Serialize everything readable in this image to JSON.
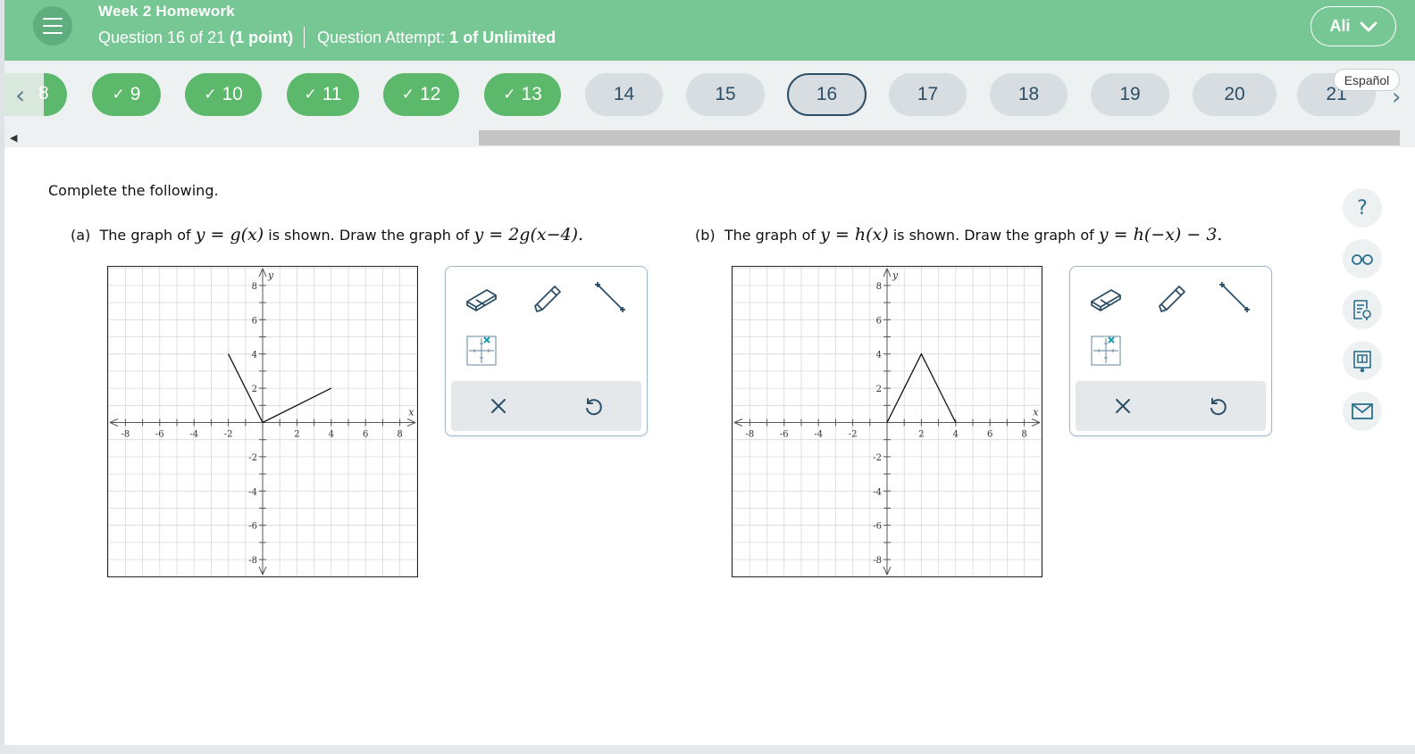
{
  "header": {
    "assignment_title": "Week 2 Homework",
    "question_label": "Question 16 of 21",
    "points_label": "(1 point)",
    "attempt_label": "Question Attempt:",
    "attempt_value": "1 of Unlimited",
    "user_name": "Ali"
  },
  "question_nav": {
    "prev_partial": "8",
    "language_button": "Español",
    "items": [
      {
        "label": "9",
        "status": "correct"
      },
      {
        "label": "10",
        "status": "correct"
      },
      {
        "label": "11",
        "status": "correct"
      },
      {
        "label": "12",
        "status": "correct"
      },
      {
        "label": "13",
        "status": "correct"
      },
      {
        "label": "14",
        "status": "unanswered"
      },
      {
        "label": "15",
        "status": "unanswered"
      },
      {
        "label": "16",
        "status": "current"
      },
      {
        "label": "17",
        "status": "unanswered"
      },
      {
        "label": "18",
        "status": "unanswered"
      },
      {
        "label": "19",
        "status": "unanswered"
      },
      {
        "label": "20",
        "status": "unanswered"
      },
      {
        "label": "21",
        "status": "unanswered"
      }
    ]
  },
  "content": {
    "instruction": "Complete the following.",
    "part_a": {
      "label": "(a)",
      "text_1": "The graph of",
      "func": "y = g(x)",
      "text_2": "is shown. Draw the graph of",
      "target": "y = 2g(x−4).",
      "graph": {
        "x_axis_label": "x",
        "y_axis_label": "y",
        "tick_labels_x": [
          "-8",
          "-6",
          "-4",
          "-2",
          "2",
          "4",
          "6",
          "8"
        ],
        "tick_labels_y": [
          "8",
          "6",
          "4",
          "2",
          "-2",
          "-4",
          "-6",
          "-8"
        ],
        "range": [
          -9,
          9
        ],
        "polyline": [
          [
            -2,
            4
          ],
          [
            0,
            0
          ],
          [
            4,
            2
          ]
        ]
      }
    },
    "part_b": {
      "label": "(b)",
      "text_1": "The graph of",
      "func": "y = h(x)",
      "text_2": "is shown. Draw the graph of",
      "target": "y = h(−x) − 3.",
      "graph": {
        "x_axis_label": "x",
        "y_axis_label": "y",
        "tick_labels_x": [
          "-8",
          "-6",
          "-4",
          "-2",
          "2",
          "4",
          "6",
          "8"
        ],
        "tick_labels_y": [
          "8",
          "6",
          "4",
          "2",
          "-2",
          "-4",
          "-6",
          "-8"
        ],
        "range": [
          -9,
          9
        ],
        "polyline": [
          [
            0,
            0
          ],
          [
            2,
            4
          ],
          [
            4,
            0
          ]
        ]
      }
    }
  },
  "toolbox": {
    "tools": [
      "eraser-icon",
      "pencil-icon",
      "line-segment-icon",
      "point-on-grid-icon"
    ],
    "actions": [
      "clear-icon",
      "undo-icon"
    ]
  },
  "side_tools": [
    "help-icon",
    "glasses-icon",
    "notes-icon",
    "textbook-icon",
    "mail-icon"
  ],
  "side_help_glyph": "?",
  "colors": {
    "header_green": "#77c795",
    "correct_green": "#5cb96b",
    "pill_grey": "#d7dde1",
    "nav_text": "#2c4e66",
    "accent_teal": "#2c6f8e"
  }
}
